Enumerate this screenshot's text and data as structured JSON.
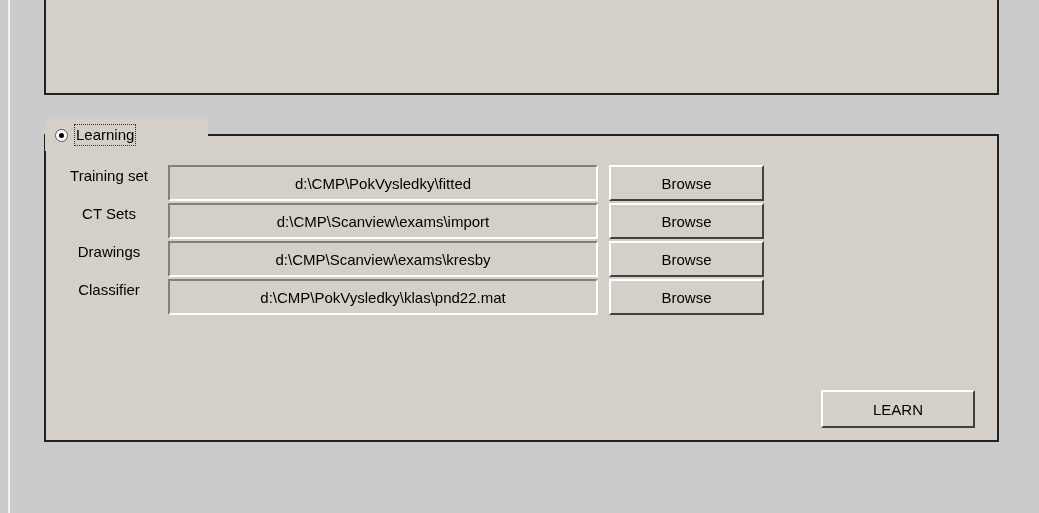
{
  "learning_group": {
    "label": "Learning",
    "selected": true,
    "focused": true,
    "rows": [
      {
        "label": "Training set",
        "value": "d:\\CMP\\PokVysledky\\fitted",
        "button": "Browse"
      },
      {
        "label": "CT Sets",
        "value": "d:\\CMP\\Scanview\\exams\\import",
        "button": "Browse"
      },
      {
        "label": "Drawings",
        "value": "d:\\CMP\\Scanview\\exams\\kresby",
        "button": "Browse"
      },
      {
        "label": "Classifier",
        "value": "d:\\CMP\\PokVysledky\\klas\\pnd22.mat",
        "button": "Browse"
      }
    ],
    "learn_button": "LEARN"
  }
}
